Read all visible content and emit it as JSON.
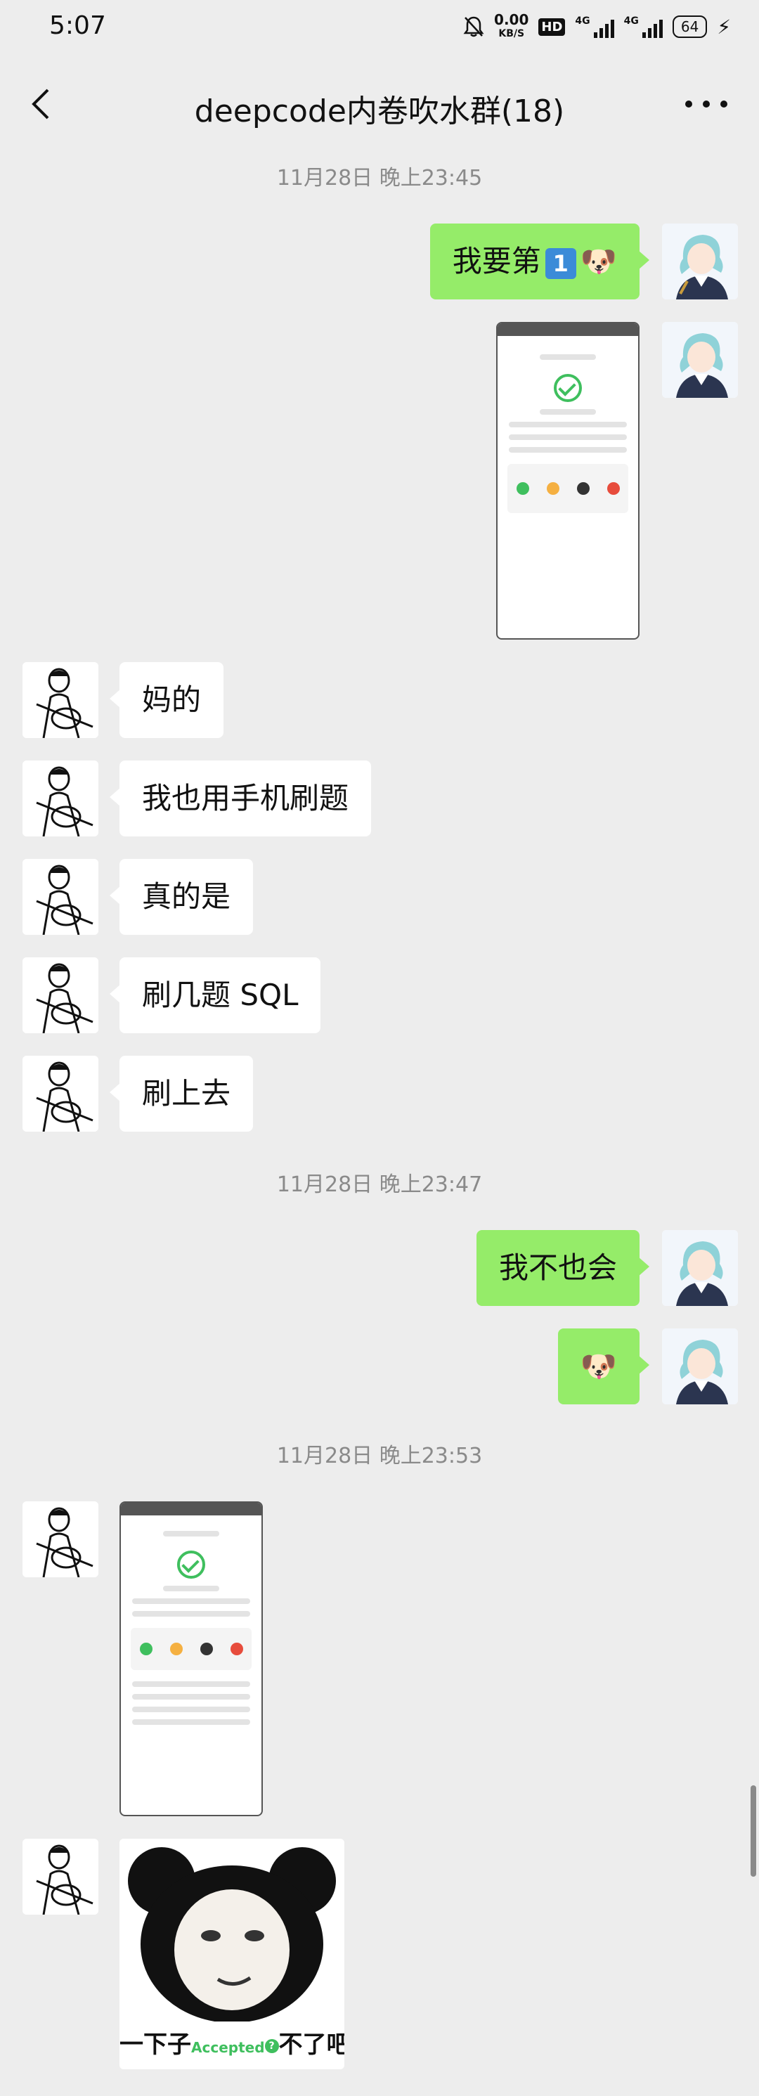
{
  "status_bar": {
    "time": "5:07",
    "net_speed_value": "0.00",
    "net_speed_unit": "KB/S",
    "hd_label": "HD",
    "network_1": "4G",
    "network_2": "4G",
    "battery": "64"
  },
  "nav": {
    "title": "deepcode内卷吹水群(18)"
  },
  "messages": {
    "ts1": "11月28日 晚上23:45",
    "m1_text_a": "我要第",
    "m1_badge": "1",
    "m1_emoji": "🐶",
    "them1": "妈的",
    "them2": "我也用手机刷题",
    "them3": "真的是",
    "them4": "刷几题 SQL",
    "them5": "刷上去",
    "ts2": "11月28日 晚上23:47",
    "m3_text": "我不也会",
    "m4_emoji": "🐶",
    "ts3": "11月28日 晚上23:53"
  },
  "sticker": {
    "caption_a": "一下子",
    "caption_accepted": "Accepted",
    "caption_q": "?",
    "caption_b": "不了吧"
  },
  "colors": {
    "background": "#ededed",
    "my_bubble": "#95ec69",
    "their_bubble": "#ffffff",
    "accent_green": "#3fbf5e",
    "timestamp": "#8a8a8a"
  }
}
